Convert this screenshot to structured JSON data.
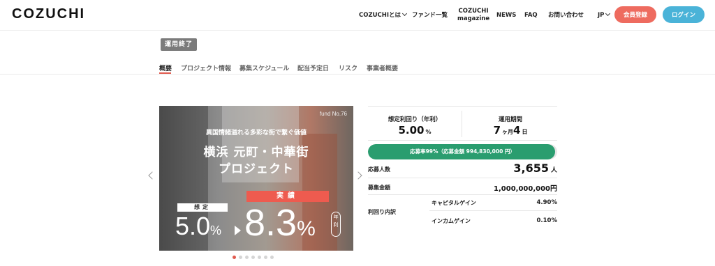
{
  "header": {
    "logo": "COZUCHI",
    "nav": {
      "about": "COZUCHIとは",
      "funds": "ファンド一覧",
      "magazine_line1": "COZUCHI",
      "magazine_line2": "magazine",
      "news": "NEWS",
      "faq": "FAQ",
      "contact": "お問い合わせ",
      "lang": "JP"
    },
    "signup_label": "会員登録",
    "login_label": "ログイン"
  },
  "status_badge": "運用終了",
  "tabs": [
    {
      "label": "概要",
      "active": true
    },
    {
      "label": "プロジェクト情報",
      "active": false
    },
    {
      "label": "募集スケジュール",
      "active": false
    },
    {
      "label": "配当予定日",
      "active": false
    },
    {
      "label": "リスク",
      "active": false
    },
    {
      "label": "事業者概要",
      "active": false
    }
  ],
  "slide": {
    "fund_no": "fund No.76",
    "catch": "異国情緒溢れる多彩な街で繋ぐ価値",
    "title_line1": "横浜 元町・中華街",
    "title_line2": "プロジェクト",
    "actual_label": "実績",
    "planned_label": "想定",
    "planned_rate": "5.0",
    "actual_rate": "8.3",
    "percent": "%",
    "annual": "年利"
  },
  "carousel": {
    "slide_count": 7,
    "active_index": 0
  },
  "info": {
    "expected_yield_label": "想定利回り（年利）",
    "expected_yield_value": "5.00",
    "expected_yield_unit": "%",
    "period_label": "運用期間",
    "period_months": "7",
    "period_months_unit": "ヶ月",
    "period_days": "4",
    "period_days_unit": "日",
    "application_rate": 0.99,
    "progress_text": "応募率99%（応募金額 994,830,000 円）",
    "applicants_label": "応募人数",
    "applicants_value": "3,655",
    "applicants_unit": "人",
    "amount_label": "募集金額",
    "amount_value": "1,000,000,000円",
    "breakdown_label": "利回り内訳",
    "capital_gain_label": "キャピタルゲイン",
    "capital_gain_value": "4.90%",
    "income_gain_label": "インカムゲイン",
    "income_gain_value": "0.10%"
  },
  "colors": {
    "accent_red": "#ee6b5f",
    "login_blue": "#4ab3d8",
    "progress_green": "#2a9d6f",
    "badge_gray": "#7b7b7b"
  }
}
